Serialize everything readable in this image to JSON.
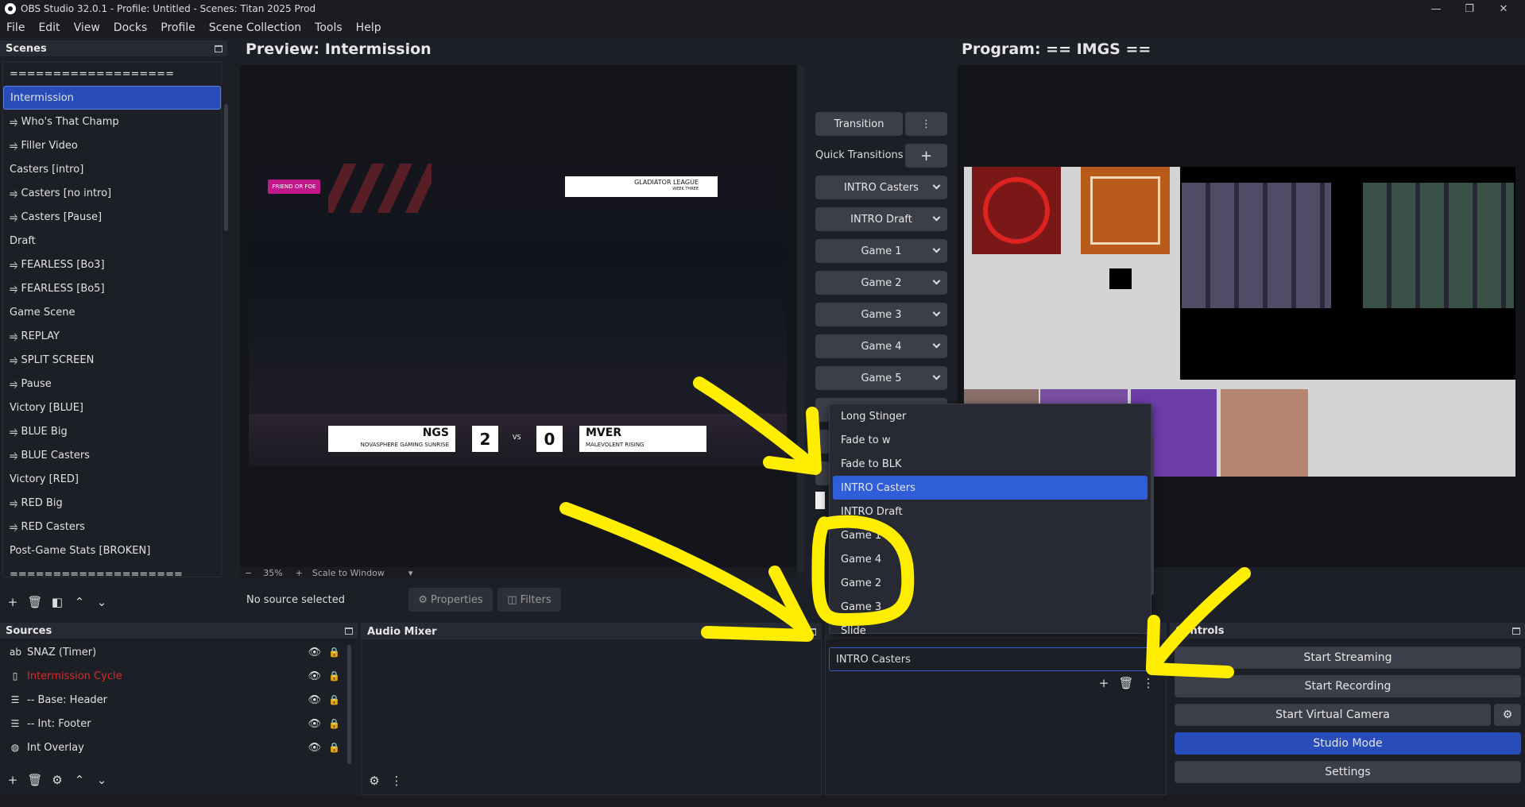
{
  "window": {
    "title": "OBS Studio 32.0.1 - Profile: Untitled - Scenes: Titan 2025 Prod"
  },
  "menu": [
    "File",
    "Edit",
    "View",
    "Docks",
    "Profile",
    "Scene Collection",
    "Tools",
    "Help"
  ],
  "scenes": {
    "title": "Scenes",
    "items": [
      "===================",
      "Intermission",
      "⥤ Who's That Champ",
      "⥤ Filler Video",
      "Casters [intro]",
      "⥤ Casters [no intro]",
      "⥤ Casters [Pause]",
      "Draft",
      "⥤ FEARLESS [Bo3]",
      "⥤ FEARLESS [Bo5]",
      "Game Scene",
      "⥤ REPLAY",
      "⥤ SPLIT SCREEN",
      "⥤ Pause",
      "Victory [BLUE]",
      "⥤ BLUE Big",
      "⥤ BLUE Casters",
      "Victory [RED]",
      "⥤ RED Big",
      "⥤ RED Casters",
      "Post-Game Stats [BROKEN]",
      "===================="
    ],
    "selected": "Intermission"
  },
  "preview": {
    "title": "Preview: Intermission",
    "zoom": "35%",
    "scale": "Scale to Window",
    "overlay": {
      "badge": "FRIEND OR FOE",
      "league": "GLADIATOR LEAGUE",
      "week": "WEEK THREE",
      "team1": "NGS",
      "team1_full": "NOVASPHERE GAMING SUNRISE",
      "score1": "2",
      "vs": "VS",
      "score2": "0",
      "team2": "MVER",
      "team2_full": "MALEVOLENT RISING"
    }
  },
  "program": {
    "title": "Program: == IMGS =="
  },
  "transitions": {
    "transition_label": "Transition",
    "quick_label": "Quick Transitions",
    "buttons": [
      "INTRO Casters",
      "INTRO Draft",
      "Game 1",
      "Game 2",
      "Game 3",
      "Game 4",
      "Game 5"
    ]
  },
  "dropdown": {
    "items": [
      "Long Stinger",
      "Fade to w",
      "Fade to BLK",
      "INTRO Casters",
      "INTRO Draft",
      "Game 1",
      "Game 4",
      "Game 2",
      "Game 3",
      "Slide"
    ],
    "selected": "INTRO Casters",
    "current_value": "INTRO Casters"
  },
  "source_bar": {
    "status": "No source selected",
    "properties": "Properties",
    "filters": "Filters"
  },
  "sources": {
    "title": "Sources",
    "items": [
      {
        "name": "SNAZ (Timer)",
        "icon": "text-icon"
      },
      {
        "name": "Intermission Cycle",
        "icon": "file-icon",
        "color": "#d62c2c"
      },
      {
        "name": "-- Base: Header",
        "icon": "list-icon"
      },
      {
        "name": "-- Int: Footer",
        "icon": "list-icon"
      },
      {
        "name": "Int Overlay",
        "icon": "globe-icon"
      }
    ]
  },
  "audio": {
    "title": "Audio Mixer"
  },
  "controls": {
    "title": "Controls",
    "start_streaming": "Start Streaming",
    "start_recording": "Start Recording",
    "start_virtual_camera": "Start Virtual Camera",
    "studio_mode": "Studio Mode",
    "settings": "Settings"
  },
  "colors": {
    "accent": "#284cb8",
    "highlight": "#ffee00",
    "red_text": "#d62c2c"
  }
}
